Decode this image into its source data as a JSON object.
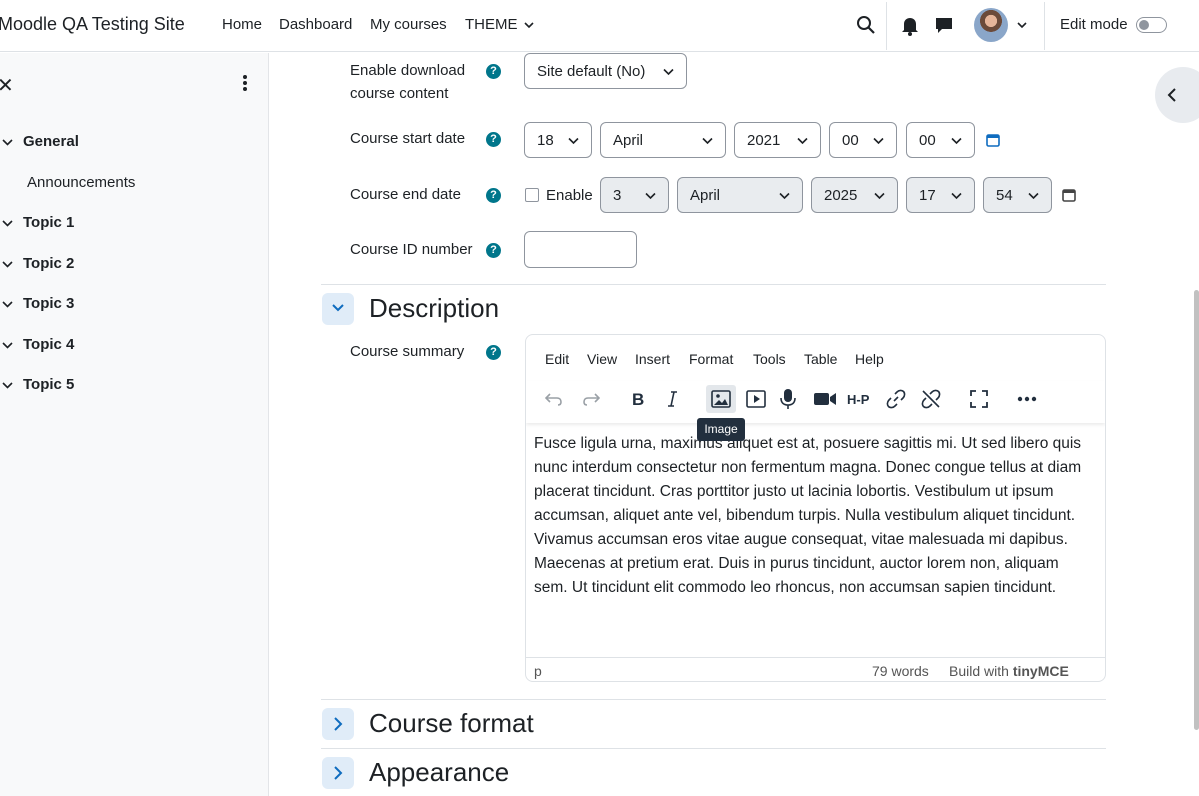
{
  "navbar": {
    "brand": "Moodle QA Testing Site",
    "links": [
      "Home",
      "Dashboard",
      "My courses",
      "THEME"
    ],
    "edit_mode_label": "Edit mode"
  },
  "drawer": {
    "sections": [
      {
        "label": "General",
        "children": [
          "Announcements"
        ]
      },
      {
        "label": "Topic 1"
      },
      {
        "label": "Topic 2"
      },
      {
        "label": "Topic 3"
      },
      {
        "label": "Topic 4"
      },
      {
        "label": "Topic 5"
      }
    ]
  },
  "form": {
    "download_label": "Enable download course content",
    "download_value": "Site default (No)",
    "start_label": "Course start date",
    "start": {
      "day": "18",
      "month": "April",
      "year": "2021",
      "hour": "00",
      "minute": "00"
    },
    "end_label": "Course end date",
    "end_enable": "Enable",
    "end": {
      "day": "3",
      "month": "April",
      "year": "2025",
      "hour": "17",
      "minute": "54"
    },
    "idnumber_label": "Course ID number",
    "help_glyph": "?"
  },
  "sections": {
    "description": "Description",
    "course_format": "Course format",
    "appearance": "Appearance"
  },
  "editor": {
    "label": "Course summary",
    "menus": [
      "Edit",
      "View",
      "Insert",
      "Format",
      "Tools",
      "Table",
      "Help"
    ],
    "tooltip": "Image",
    "content": "Fusce ligula urna, maximus aliquet est at, posuere sagittis mi. Ut sed libero quis nunc interdum consectetur non fermentum magna. Donec congue tellus at diam placerat tincidunt. Cras porttitor justo ut lacinia lobortis. Vestibulum ut ipsum accumsan, aliquet ante vel, bibendum turpis. Nulla vestibulum aliquet tincidunt. Vivamus accumsan eros vitae augue consequat, vitae malesuada mi dapibus. Maecenas at pretium erat. Duis in purus tincidunt, auctor lorem non, aliquam sem. Ut tincidunt elit commodo leo rhoncus, non accumsan sapien tincidunt.",
    "status_path": "p",
    "word_count": "79 words",
    "build_with": "Build with",
    "tinymce": "tinyMCE"
  },
  "colors": {
    "help": "#00768b",
    "accent": "#0f6cbf"
  }
}
